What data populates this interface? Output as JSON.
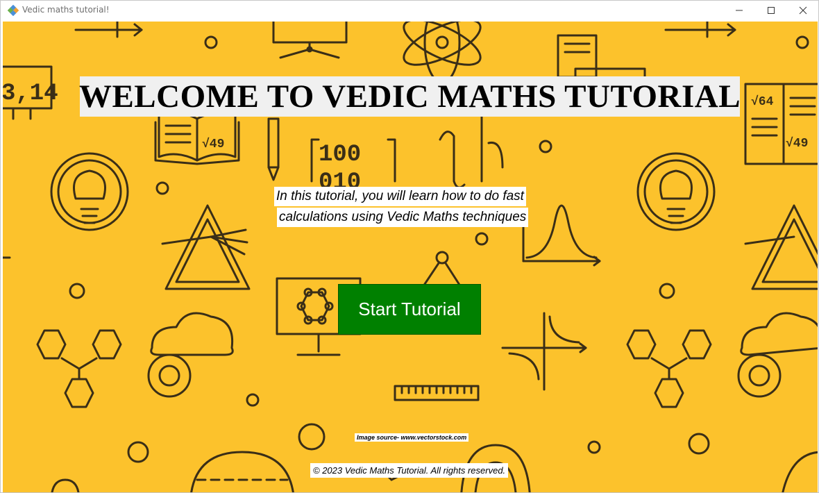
{
  "window": {
    "title": "Vedic maths tutorial!",
    "icon": "feather-diamond-icon",
    "controls": [
      "minimize-icon",
      "maximize-icon",
      "close-icon"
    ]
  },
  "main": {
    "heading": "WELCOME TO VEDIC MATHS TUTORIAL",
    "intro_line1": "In this tutorial, you will learn how to do fast",
    "intro_line2": "calculations using Vedic Maths techniques",
    "start_button": "Start Tutorial",
    "image_source": "Image source- www.vectorstock.com",
    "footer": "© 2023 Vedic Maths Tutorial. All rights reserved."
  },
  "background_art": {
    "pi_text": "3,14",
    "sqrt_text_1": "√64",
    "sqrt_text_2": "√49",
    "sqrt_text_3": "√49",
    "binary_text_1": "100",
    "binary_text_2": "010"
  },
  "colors": {
    "background": "#fcc22c",
    "line_art": "#3a2e17",
    "button": "#008000",
    "heading_box": "#f0f0f0"
  }
}
